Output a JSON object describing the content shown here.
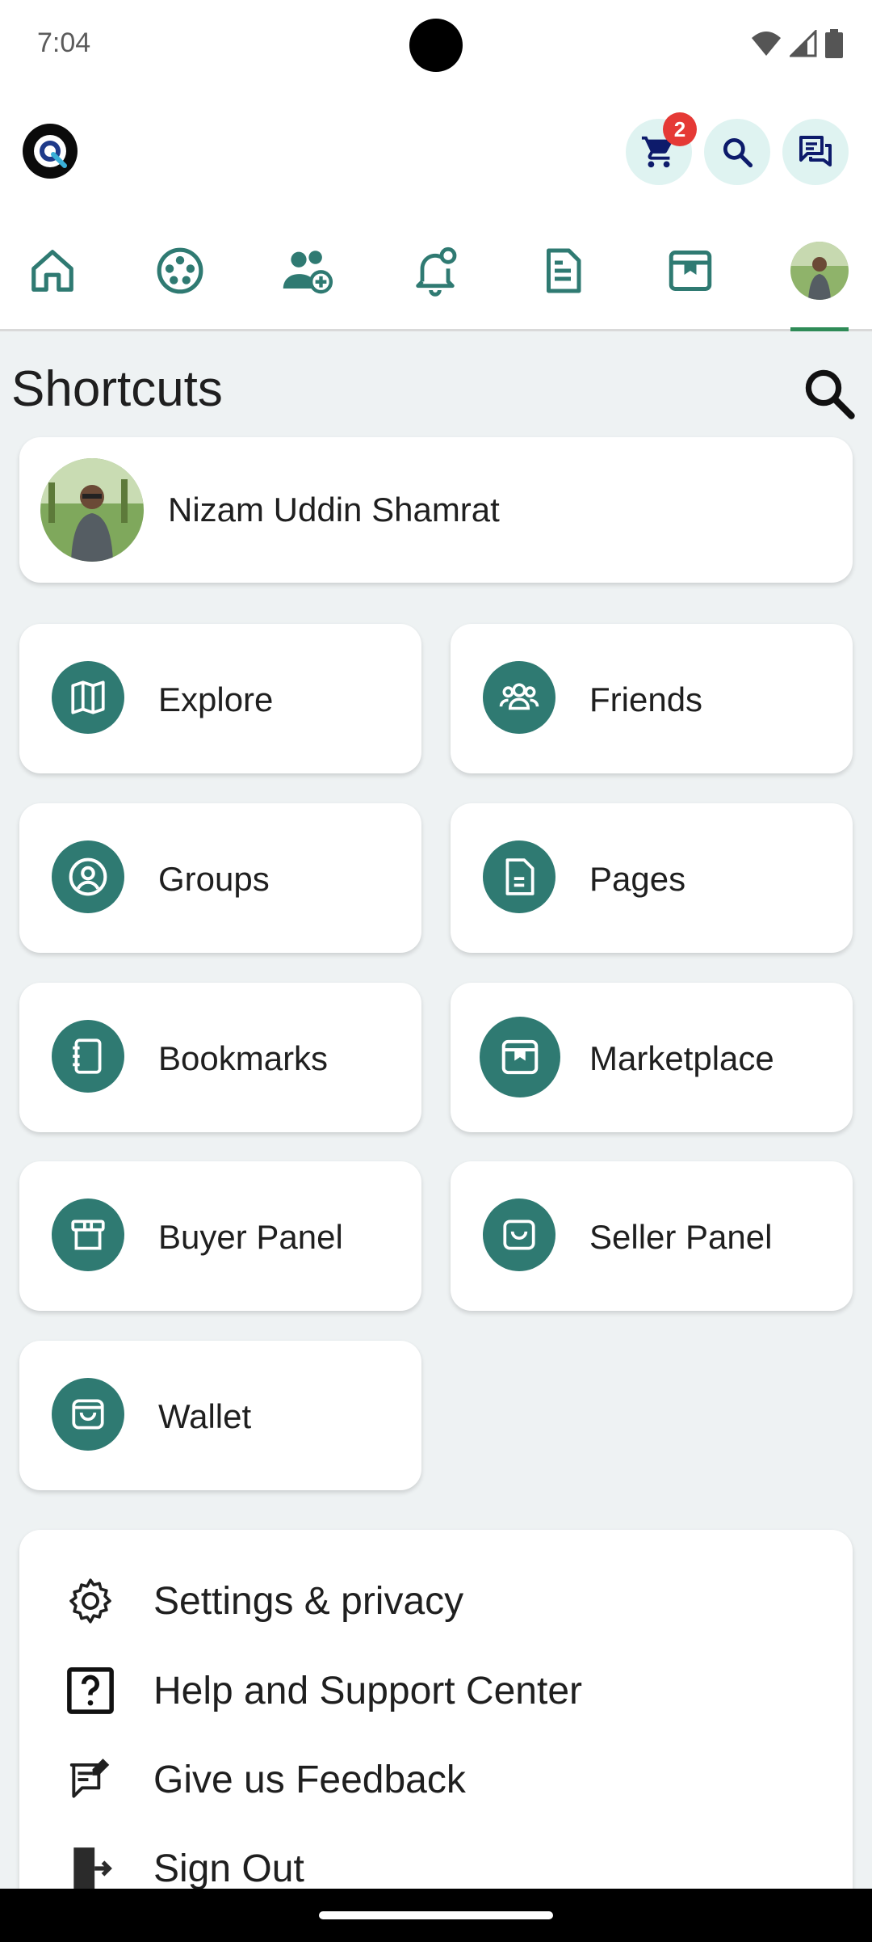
{
  "status_bar": {
    "time": "7:04"
  },
  "header": {
    "cart_badge_count": "2"
  },
  "nav": {
    "items": [
      "home",
      "reels",
      "friends",
      "notifications",
      "pages",
      "marketplace",
      "profile"
    ],
    "active": "profile",
    "active_color": "#2e8b57"
  },
  "shortcuts": {
    "title": "Shortcuts",
    "profile_name": "Nizam Uddin Shamrat",
    "tiles": [
      {
        "label": "Explore",
        "icon": "map-icon"
      },
      {
        "label": "Friends",
        "icon": "group-icon"
      },
      {
        "label": "Groups",
        "icon": "user-circle-icon"
      },
      {
        "label": "Pages",
        "icon": "document-icon"
      },
      {
        "label": "Bookmarks",
        "icon": "notebook-icon"
      },
      {
        "label": "Marketplace",
        "icon": "store-icon"
      },
      {
        "label": "Buyer Panel",
        "icon": "box-icon"
      },
      {
        "label": "Seller Panel",
        "icon": "bag-icon"
      },
      {
        "label": "Wallet",
        "icon": "wallet-icon"
      }
    ]
  },
  "menu": {
    "settings": "Settings & privacy",
    "help": "Help and Support Center",
    "feedback": "Give us Feedback",
    "signout": "Sign Out"
  },
  "colors": {
    "accent": "#2f7a72",
    "accent_light": "#dff3f1",
    "badge": "#e53935"
  }
}
